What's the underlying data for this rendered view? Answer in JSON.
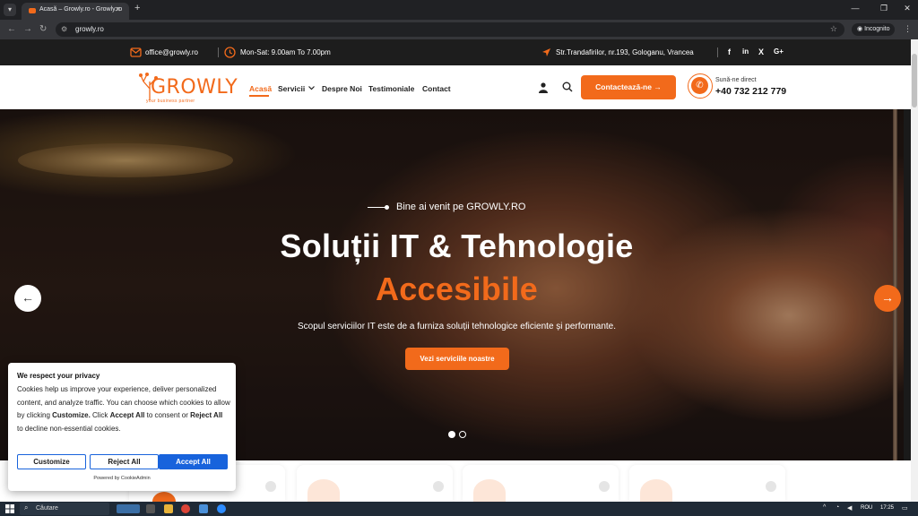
{
  "browser": {
    "tab_title": "Acasă – Growly.ro - Growly.ro",
    "url": "growly.ro",
    "incognito_label": "Incognito"
  },
  "topbar": {
    "email": "office@growly.ro",
    "hours": "Mon-Sat: 9.00am To 7.00pm",
    "address": "Str.Trandafirilor, nr.193, Gologanu, Vrancea",
    "socials": [
      "f",
      "in",
      "X",
      "G+"
    ]
  },
  "header": {
    "logo_text": "GROWLY",
    "logo_tagline": "your business partner",
    "nav": [
      "Acasă",
      "Servicii",
      "Despre Noi",
      "Testimoniale",
      "Contact"
    ],
    "cta_label": "Contactează-ne →",
    "phone_label": "Sună-ne direct",
    "phone_number": "+40 732 212 779"
  },
  "hero": {
    "pretitle": "Bine ai venit pe GROWLY.RO",
    "title_line1": "Soluții IT & Tehnologie",
    "title_line2": "Accesibile",
    "subtitle": "Scopul serviciilor IT este de a furniza soluții tehnologice eficiente și performante.",
    "button_label": "Vezi serviciile noastre",
    "slides_total": 2,
    "slide_active": 1
  },
  "cookie": {
    "title": "We respect your privacy",
    "body_1": "Cookies help us improve your experience, deliver personalized content, and analyze traffic. You can choose which cookies to allow by clicking ",
    "body_customize": "Customize.",
    "body_2": " Click ",
    "body_accept": "Accept All",
    "body_3": " to consent or ",
    "body_reject": "Reject All",
    "body_4": " to decline non-essential cookies.",
    "btn_customize": "Customize",
    "btn_reject": "Reject All",
    "btn_accept": "Accept All",
    "powered": "Powered by CookieAdmin"
  },
  "taskbar": {
    "search_placeholder": "Căutare",
    "lang": "ROU",
    "time": "17:25"
  },
  "colors": {
    "accent": "#f26a1b",
    "dark": "#1d1d1d",
    "cookie_blue": "#1863dc"
  }
}
